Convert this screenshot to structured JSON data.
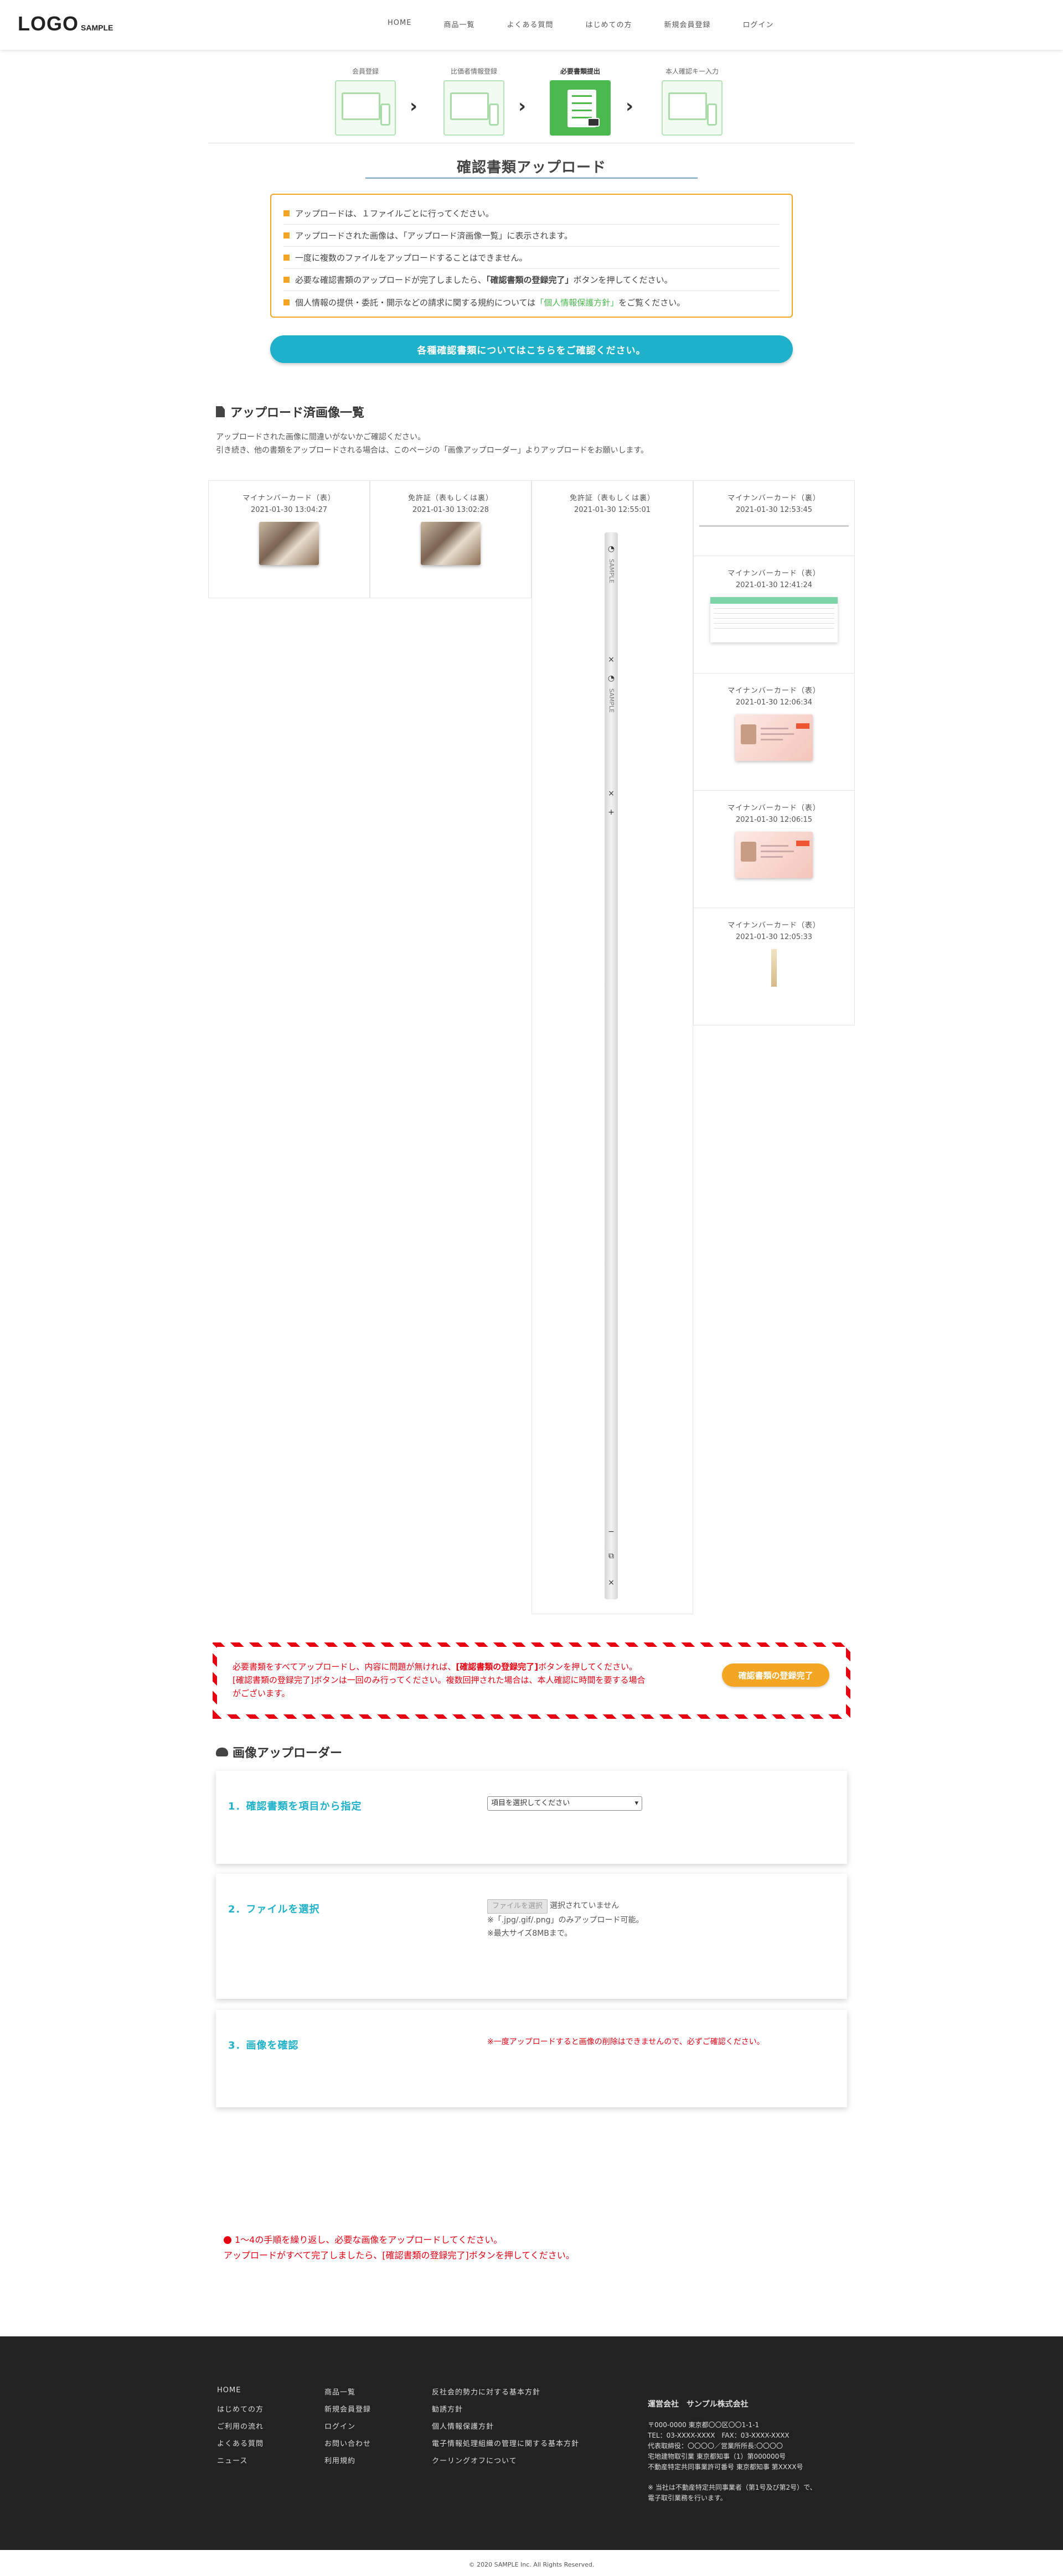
{
  "header": {
    "logo": "LOGO",
    "logo_sub": "SAMPLE",
    "nav": [
      "HOME",
      "商品一覧",
      "よくある質問",
      "はじめての方",
      "新規会員登録",
      "ログイン"
    ]
  },
  "steps": [
    {
      "label": "会員登録",
      "active": false
    },
    {
      "label": "比価者情報登録",
      "active": false
    },
    {
      "label": "必要書類提出",
      "active": true
    },
    {
      "label": "本人確認キー入力",
      "active": false
    }
  ],
  "page_title": "確認書類アップロード",
  "notices": [
    "アップロードは、１ファイルごとに行ってください。",
    "アップロードされた画像は、「アップロード済画像一覧」に表示されます。",
    "一度に複数のファイルをアップロードすることはできません。",
    "必要な確認書類のアップロードが完了しましたら、「確認書類の登録完了」ボタンを押してください。",
    "個人情報の提供・委託・開示などの請求に関する規約については「個人情報保護方針」をご覧ください。"
  ],
  "notice_bold": "「確認書類の登録完了」",
  "notice_link": "「個人情報保護方針」",
  "info_button": "各種確認書類についてはこちらをご確認ください。",
  "uploaded": {
    "title": "アップロード済画像一覧",
    "desc1": "アップロードされた画像に間違いがないかご確認ください。",
    "desc2": "引き続き、他の書類をアップロードされる場合は、このページの「画像アップローダー」よりアップロードをお願いします。",
    "col1": [
      {
        "title": "マイナンバーカード（表）",
        "date": "2021-01-30 13:04:27"
      }
    ],
    "col2": [
      {
        "title": "免許証（表もしくは裏）",
        "date": "2021-01-30 13:02:28"
      }
    ],
    "col3": [
      {
        "title": "免許証（表もしくは裏）",
        "date": "2021-01-30 12:55:01"
      }
    ],
    "col4": [
      {
        "title": "マイナンバーカード（裏）",
        "date": "2021-01-30 12:53:45"
      },
      {
        "title": "マイナンバーカード（表）",
        "date": "2021-01-30 12:41:24"
      },
      {
        "title": "マイナンバーカード（表）",
        "date": "2021-01-30 12:06:34"
      },
      {
        "title": "マイナンバーカード（表）",
        "date": "2021-01-30 12:06:15"
      },
      {
        "title": "マイナンバーカード（表）",
        "date": "2021-01-30 12:05:33"
      }
    ],
    "viewer_text": "SAMPLE"
  },
  "warning": {
    "line1_a": "必要書類をすべてアップロードし、内容に問題が無ければ、",
    "line1_b": "[確認書類の登録完了]",
    "line1_c": "ボタンを押してください。",
    "line2": "[確認書類の登録完了]ボタンは一回のみ行ってください。複数回押された場合は、本人確認に時間を要する場合",
    "line3": "がございます。",
    "button": "確認書類の登録完了"
  },
  "uploader": {
    "title": "画像アップローダー",
    "step1_label": "1．確認書類を項目から指定",
    "step1_select": "項目を選択してください",
    "step2_label": "2．ファイルを選択",
    "step2_button": "ファイルを選択",
    "step2_none": "選択されていません",
    "step2_note1": "※「.jpg/.gif/.png」のみアップロード可能。",
    "step2_note2": "※最大サイズ8MBまで。",
    "step3_label": "3．画像を確認",
    "step3_note": "※一度アップロードすると画像の削除はできませんので、必ずご確認ください。"
  },
  "bottom_note": {
    "line1": "1〜4の手順を繰り返し、必要な画像をアップロードしてください。",
    "line2": "アップロードがすべて完了しましたら、[確認書類の登録完了]ボタンを押してください。"
  },
  "footer": {
    "col1": [
      "HOME",
      "はじめての方",
      "ご利用の流れ",
      "よくある質問",
      "ニュース"
    ],
    "col2": [
      "商品一覧",
      "新規会員登録",
      "ログイン",
      "お問い合わせ",
      "利用規約"
    ],
    "col3": [
      "反社会的勢力に対する基本方針",
      "勧誘方針",
      "個人情報保護方針",
      "電子情報処理組織の管理に関する基本方針",
      "クーリングオフについて"
    ],
    "company": {
      "name": "運営会社　サンプル株式会社",
      "lines": [
        "〒000-0000 東京都〇〇区〇〇1-1-1",
        "TEL：03-XXXX-XXXX　FAX：03-XXXX-XXXX",
        "代表取締役：〇〇〇〇／営業所所長:〇〇〇〇",
        "宅地建物取引業 東京都知事（1）第000000号",
        "不動産特定共同事業許可番号 東京都知事 第XXXX号"
      ],
      "note1": "※ 当社は不動産特定共同事業者（第1号及び第2号）で、",
      "note2": "電子取引業務を行います。"
    },
    "copyright": "© 2020 SAMPLE Inc. All Rights Reserved."
  }
}
